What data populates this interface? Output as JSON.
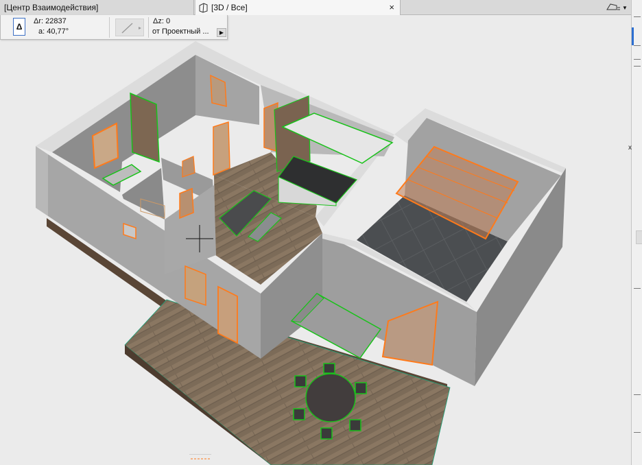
{
  "tabs": [
    {
      "label": "[Центр Взаимодействия]",
      "active": false
    },
    {
      "label": "[3D / Все]",
      "active": true
    }
  ],
  "tab_close_glyph": "×",
  "view_menu": {
    "icon": "perspective-view-icon",
    "arrow": "▼"
  },
  "info_box": {
    "delta_button": "Δ",
    "dr_label": "Δr:",
    "dr_value": "22837",
    "a_label": "a:",
    "a_value": "40,77°",
    "dz_label": "Δz:",
    "dz_value": "0",
    "reference": "от Проектный ...",
    "arrow": "▶"
  },
  "right_strip": {
    "axis_label": "x"
  },
  "colors": {
    "selection_orange": "#ff7a1a",
    "selection_green": "#19c21a",
    "wall": "#9c9c9c",
    "wall_top": "#d8d8d8",
    "floor_wood": "#7a6a58",
    "tile_floor": "#4a4d50",
    "background": "#ebebeb",
    "active_accent": "#2d6fd1"
  }
}
